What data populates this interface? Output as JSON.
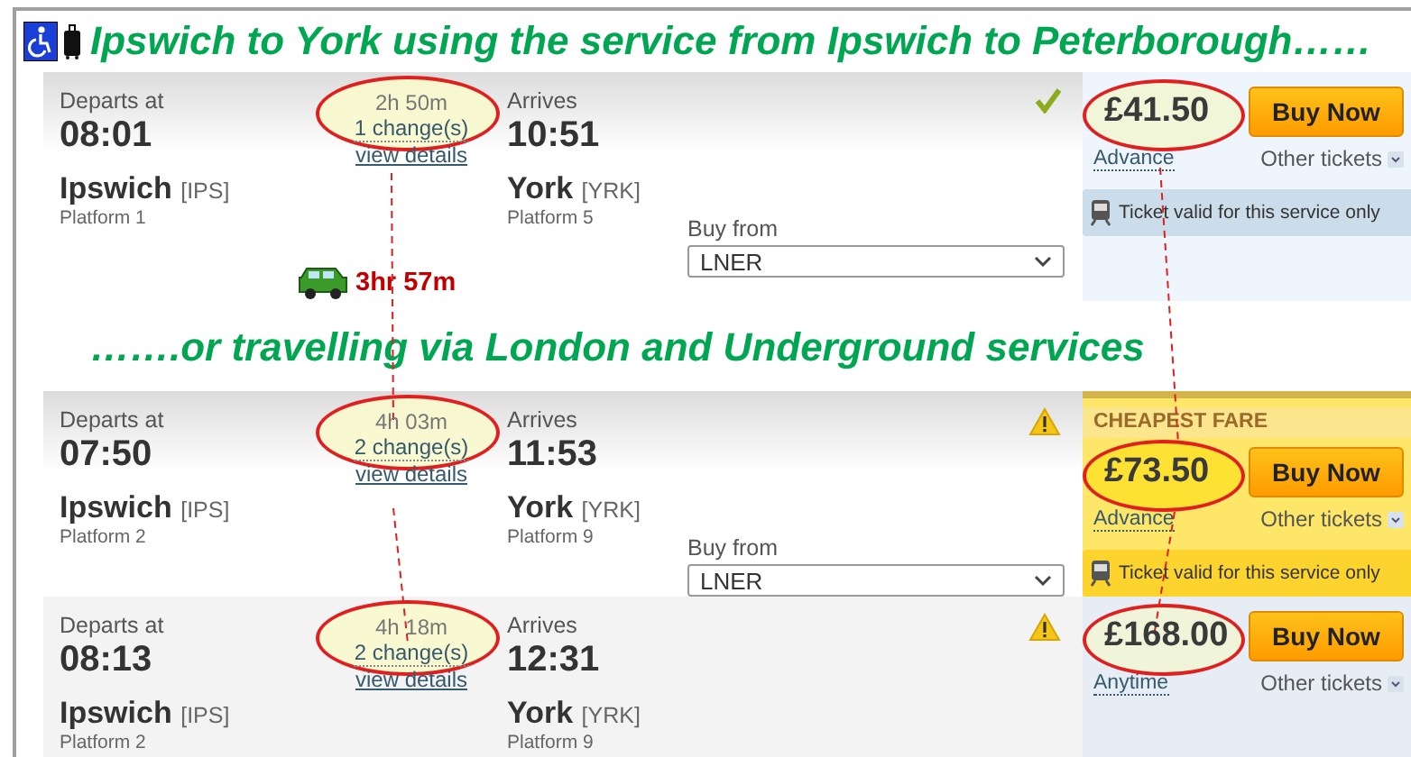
{
  "title": "Ipswich to York using the service from Ipswich to Peterborough……",
  "journeys": [
    {
      "depart_label": "Departs at",
      "depart_time": "08:01",
      "from": "Ipswich",
      "from_code": "[IPS]",
      "from_platform": "Platform 1",
      "duration": "2h 50m",
      "changes": "1 change(s)",
      "details": "view details",
      "highlighted": true,
      "arrive_label": "Arrives",
      "arrive_time": "10:51",
      "to": "York",
      "to_code": "[YRK]",
      "to_platform": "Platform 5",
      "kind": "ok",
      "buy_from_label": "Buy from",
      "operator": "LNER",
      "cheapest": false,
      "price": "£41.50",
      "price_highlighted": true,
      "buy_label": "Buy Now",
      "fare_type": "Advance",
      "other_tickets": "Other tickets",
      "validity": "Ticket valid for this service only"
    },
    {
      "depart_label": "Departs at",
      "depart_time": "07:50",
      "from": "Ipswich",
      "from_code": "[IPS]",
      "from_platform": "Platform 2",
      "duration": "4h 03m",
      "changes": "2 change(s)",
      "details": "view details",
      "highlighted": true,
      "arrive_label": "Arrives",
      "arrive_time": "11:53",
      "to": "York",
      "to_code": "[YRK]",
      "to_platform": "Platform 9",
      "kind": "warning",
      "buy_from_label": "Buy from",
      "operator": "LNER",
      "cheapest": true,
      "badge": "CHEAPEST FARE",
      "price": "£73.50",
      "price_highlighted": true,
      "buy_label": "Buy Now",
      "fare_type": "Advance",
      "other_tickets": "Other tickets",
      "validity": "Ticket valid for this service only"
    },
    {
      "depart_label": "Departs at",
      "depart_time": "08:13",
      "from": "Ipswich",
      "from_code": "[IPS]",
      "from_platform": "Platform 2",
      "duration": "4h 18m",
      "changes": "2 change(s)",
      "details": "view details",
      "highlighted": true,
      "arrive_label": "Arrives",
      "arrive_time": "12:31",
      "to": "York",
      "to_code": "[YRK]",
      "to_platform": "Platform 9",
      "kind": "warning",
      "cheapest": false,
      "price": "£168.00",
      "price_highlighted": true,
      "buy_label": "Buy Now",
      "fare_type": "Anytime",
      "other_tickets": "Other tickets"
    }
  ],
  "drive_time": "3hr 57m",
  "alternative": "…….or  travelling via London and Underground services"
}
